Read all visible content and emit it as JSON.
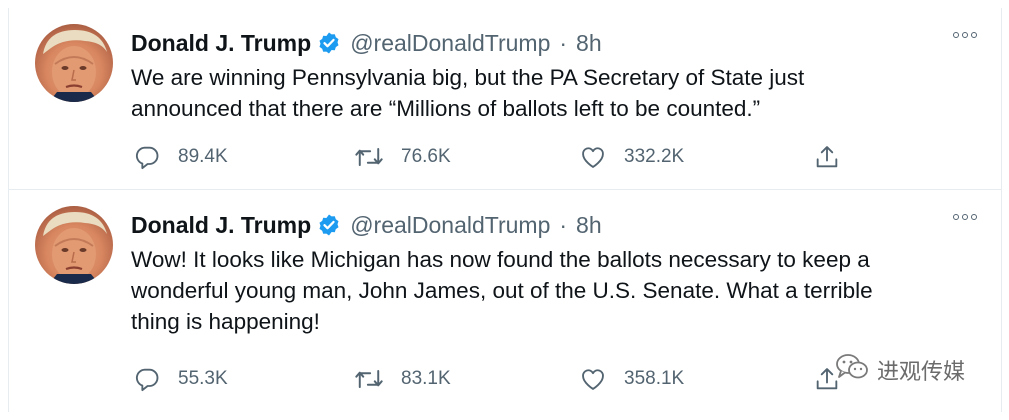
{
  "tweets": [
    {
      "display_name": "Donald J. Trump",
      "handle": "@realDonaldTrump",
      "separator": "·",
      "time": "8h",
      "text": "We are winning Pennsylvania big, but the PA Secretary of State just\nannounced that there are “Millions of ballots left to be counted.”",
      "replies": "89.4K",
      "retweets": "76.6K",
      "likes": "332.2K"
    },
    {
      "display_name": "Donald J. Trump",
      "handle": "@realDonaldTrump",
      "separator": "·",
      "time": "8h",
      "text": "Wow! It looks like Michigan has now found the ballots necessary to keep a\nwonderful young man, John James, out of the U.S. Senate. What a terrible\nthing is happening!",
      "replies": "55.3K",
      "retweets": "83.1K",
      "likes": "358.1K"
    }
  ],
  "watermark": {
    "text": "进观传媒"
  },
  "colors": {
    "verified": "#1d9bf0",
    "muted": "#536471",
    "text": "#0f1419",
    "border": "#e6ecf0"
  }
}
